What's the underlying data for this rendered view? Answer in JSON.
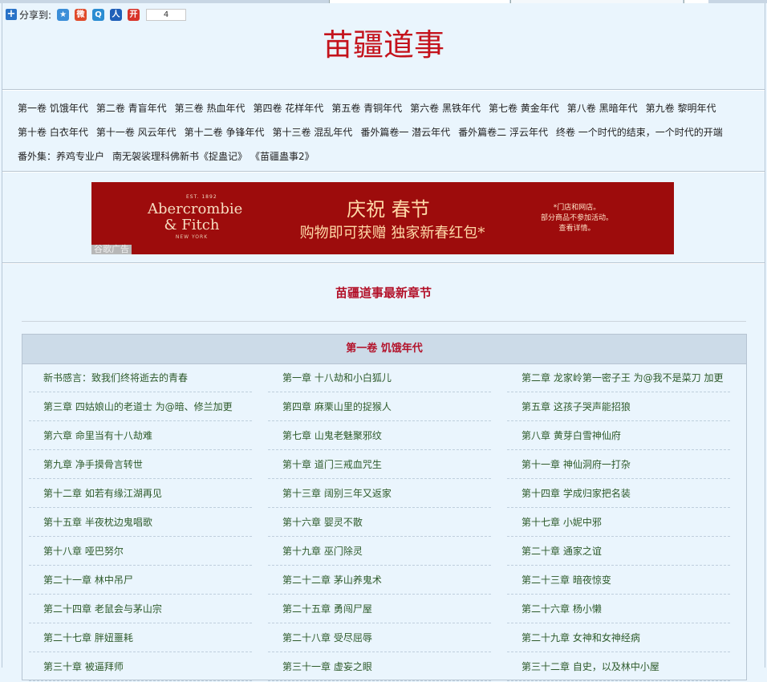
{
  "share": {
    "label": "分享到:",
    "count": "4",
    "icons": [
      {
        "name": "qzone-icon",
        "glyph": "★",
        "color": "#3b8ed8"
      },
      {
        "name": "weibo-icon",
        "glyph": "微",
        "color": "#e04a2a"
      },
      {
        "name": "tqq-icon",
        "glyph": "Q",
        "color": "#2b8dd2"
      },
      {
        "name": "renren-icon",
        "glyph": "人",
        "color": "#1f5fb8"
      },
      {
        "name": "kaixin-icon",
        "glyph": "开",
        "color": "#d8342a"
      }
    ]
  },
  "site_title": "苗疆道事",
  "volumes": [
    [
      "第一卷 饥饿年代",
      "第二卷 青盲年代",
      "第三卷 热血年代",
      "第四卷 花样年代",
      "第五卷 青铜年代",
      "第六卷 黑铁年代",
      "第七卷 黄金年代",
      "第八卷 黑暗年代",
      "第九卷 黎明年代"
    ],
    [
      "第十卷 白衣年代",
      "第十一卷 风云年代",
      "第十二卷 争锋年代",
      "第十三卷 混乱年代",
      "番外篇卷一 潜云年代",
      "番外篇卷二 浮云年代",
      "终卷 一个时代的结束，一个时代的开端"
    ],
    [
      "番外集：养鸡专业户",
      "南无袈裟理科佛新书《捉蛊记》",
      "《苗疆蛊事2》"
    ]
  ],
  "ad": {
    "brand_top": "EST. 1892",
    "brand": "Abercrombie & Fitch",
    "brand_bottom": "NEW YORK",
    "headline": "庆祝 春节",
    "subline": "购物即可获赠 独家新春红包*",
    "note_lines": [
      "*门店和网店。",
      "部分商品不参加活动。",
      "查看详情。"
    ],
    "label": "谷歌广告"
  },
  "latest_title": "苗疆道事最新章节",
  "volume_header": "第一卷 饥饿年代",
  "chapters": [
    [
      "新书感言：致我们终将逝去的青春",
      "第一章 十八劫和小白狐儿",
      "第二章 龙家岭第一密子王 为@我不是菜刀 加更"
    ],
    [
      "第三章 四姑娘山的老道士 为@暗、修兰加更",
      "第四章 麻栗山里的捉猴人",
      "第五章 这孩子哭声能招狼"
    ],
    [
      "第六章 命里当有十八劫难",
      "第七章 山鬼老魅聚邪纹",
      "第八章 黄芽白雪神仙府"
    ],
    [
      "第九章 净手摸骨言转世",
      "第十章 道门三戒血咒生",
      "第十一章 神仙洞府一打杂"
    ],
    [
      "第十二章 如若有缘江湖再见",
      "第十三章 阔别三年又返家",
      "第十四章 学成归家把名装"
    ],
    [
      "第十五章 半夜枕边鬼唱歌",
      "第十六章 婴灵不散",
      "第十七章 小妮中邪"
    ],
    [
      "第十八章 哑巴努尔",
      "第十九章 巫门除灵",
      "第二十章 通家之谊"
    ],
    [
      "第二十一章 林中吊尸",
      "第二十二章 茅山养鬼术",
      "第二十三章 暗夜惊变"
    ],
    [
      "第二十四章 老鼠会与茅山宗",
      "第二十五章 勇闯尸屋",
      "第二十六章 杨小懒"
    ],
    [
      "第二十七章 胖妞噩耗",
      "第二十八章 受尽屈辱",
      "第二十九章 女神和女神经病"
    ],
    [
      "第三十章 被逼拜师",
      "第三十一章 虚妄之眼",
      "第三十二章 自史，以及林中小屋"
    ]
  ]
}
